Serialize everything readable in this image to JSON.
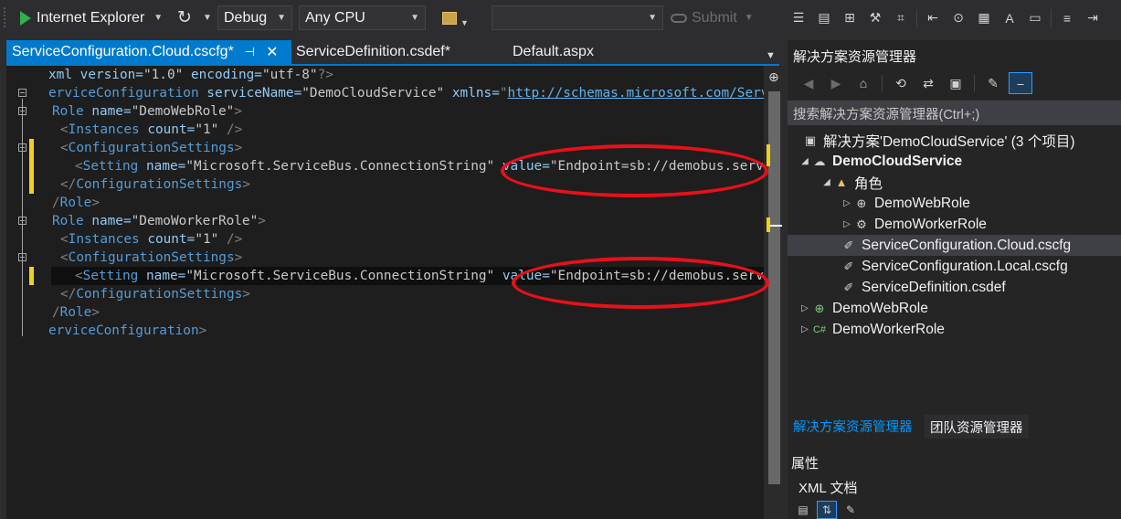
{
  "toolbar": {
    "run_target": "Internet Explorer",
    "configuration": "Debug",
    "platform": "Any CPU",
    "empty_combo_value": "",
    "submit_label": "Submit"
  },
  "editor_tabs": [
    {
      "label": "ServiceConfiguration.Cloud.cscfg*",
      "active": true
    },
    {
      "label": "ServiceDefinition.csdef*",
      "active": false
    },
    {
      "label": "Default.aspx",
      "active": false
    }
  ],
  "code": {
    "l1": {
      "a": "xml version=",
      "b": "\"1.0\"",
      "c": " encoding=",
      "d": "\"utf-8\"",
      "e": "?>"
    },
    "l2": {
      "tag": "erviceConfiguration",
      "a1": " serviceName=",
      "v1": "\"DemoCloudService\"",
      "a2": " xmlns=",
      "url": "http://schemas.microsoft.com/ServiceHos"
    },
    "l3": {
      "tag": "Role",
      "a": " name=",
      "v": "\"DemoWebRole\"",
      "e": ">"
    },
    "l4": {
      "tag": "Instances",
      "a": " count=",
      "v": "\"1\"",
      "e": " />"
    },
    "l5": {
      "tag": "ConfigurationSettings",
      "e": ">"
    },
    "l6": {
      "tag": "Setting",
      "a1": " name=",
      "v1": "\"Microsoft.ServiceBus.ConnectionString\"",
      "a2": " value=",
      "v2": "\"Endpoint=sb://demobus.servicebus"
    },
    "l7": {
      "tag": "ConfigurationSettings",
      "e": ">"
    },
    "l8": {
      "tag": "Role",
      "e": ">"
    },
    "l9": {
      "tag": "Role",
      "a": " name=",
      "v": "\"DemoWorkerRole\"",
      "e": ">"
    },
    "l10": {
      "tag": "Instances",
      "a": " count=",
      "v": "\"1\"",
      "e": " />"
    },
    "l11": {
      "tag": "ConfigurationSettings",
      "e": ">"
    },
    "l12": {
      "tag": "Setting",
      "a1": " name=",
      "v1": "\"Microsoft.ServiceBus.ConnectionString\"",
      "a2": " value=",
      "v2": "\"Endpoint=sb://demobus.servicebus"
    },
    "l13": {
      "tag": "ConfigurationSettings",
      "e": ">"
    },
    "l14": {
      "tag": "Role",
      "e": ">"
    },
    "l15": {
      "tag": "erviceConfiguration",
      "e": ">"
    }
  },
  "solution_explorer": {
    "title": "解决方案资源管理器",
    "search_placeholder": "搜索解决方案资源管理器(Ctrl+;)",
    "tree": [
      {
        "label": "解决方案'DemoCloudService' (3 个项目)"
      },
      {
        "label": "DemoCloudService"
      },
      {
        "label": "角色"
      },
      {
        "label": "DemoWebRole"
      },
      {
        "label": "DemoWorkerRole"
      },
      {
        "label": "ServiceConfiguration.Cloud.cscfg"
      },
      {
        "label": "ServiceConfiguration.Local.cscfg"
      },
      {
        "label": "ServiceDefinition.csdef"
      },
      {
        "label": "DemoWebRole"
      },
      {
        "label": "DemoWorkerRole"
      }
    ],
    "bottom_tabs": [
      "解决方案资源管理器",
      "团队资源管理器"
    ]
  },
  "properties": {
    "title": "属性",
    "object": "XML 文档"
  },
  "colors": {
    "accent": "#007acc",
    "annotation": "#e8101a",
    "change_marker": "#efd21a"
  }
}
